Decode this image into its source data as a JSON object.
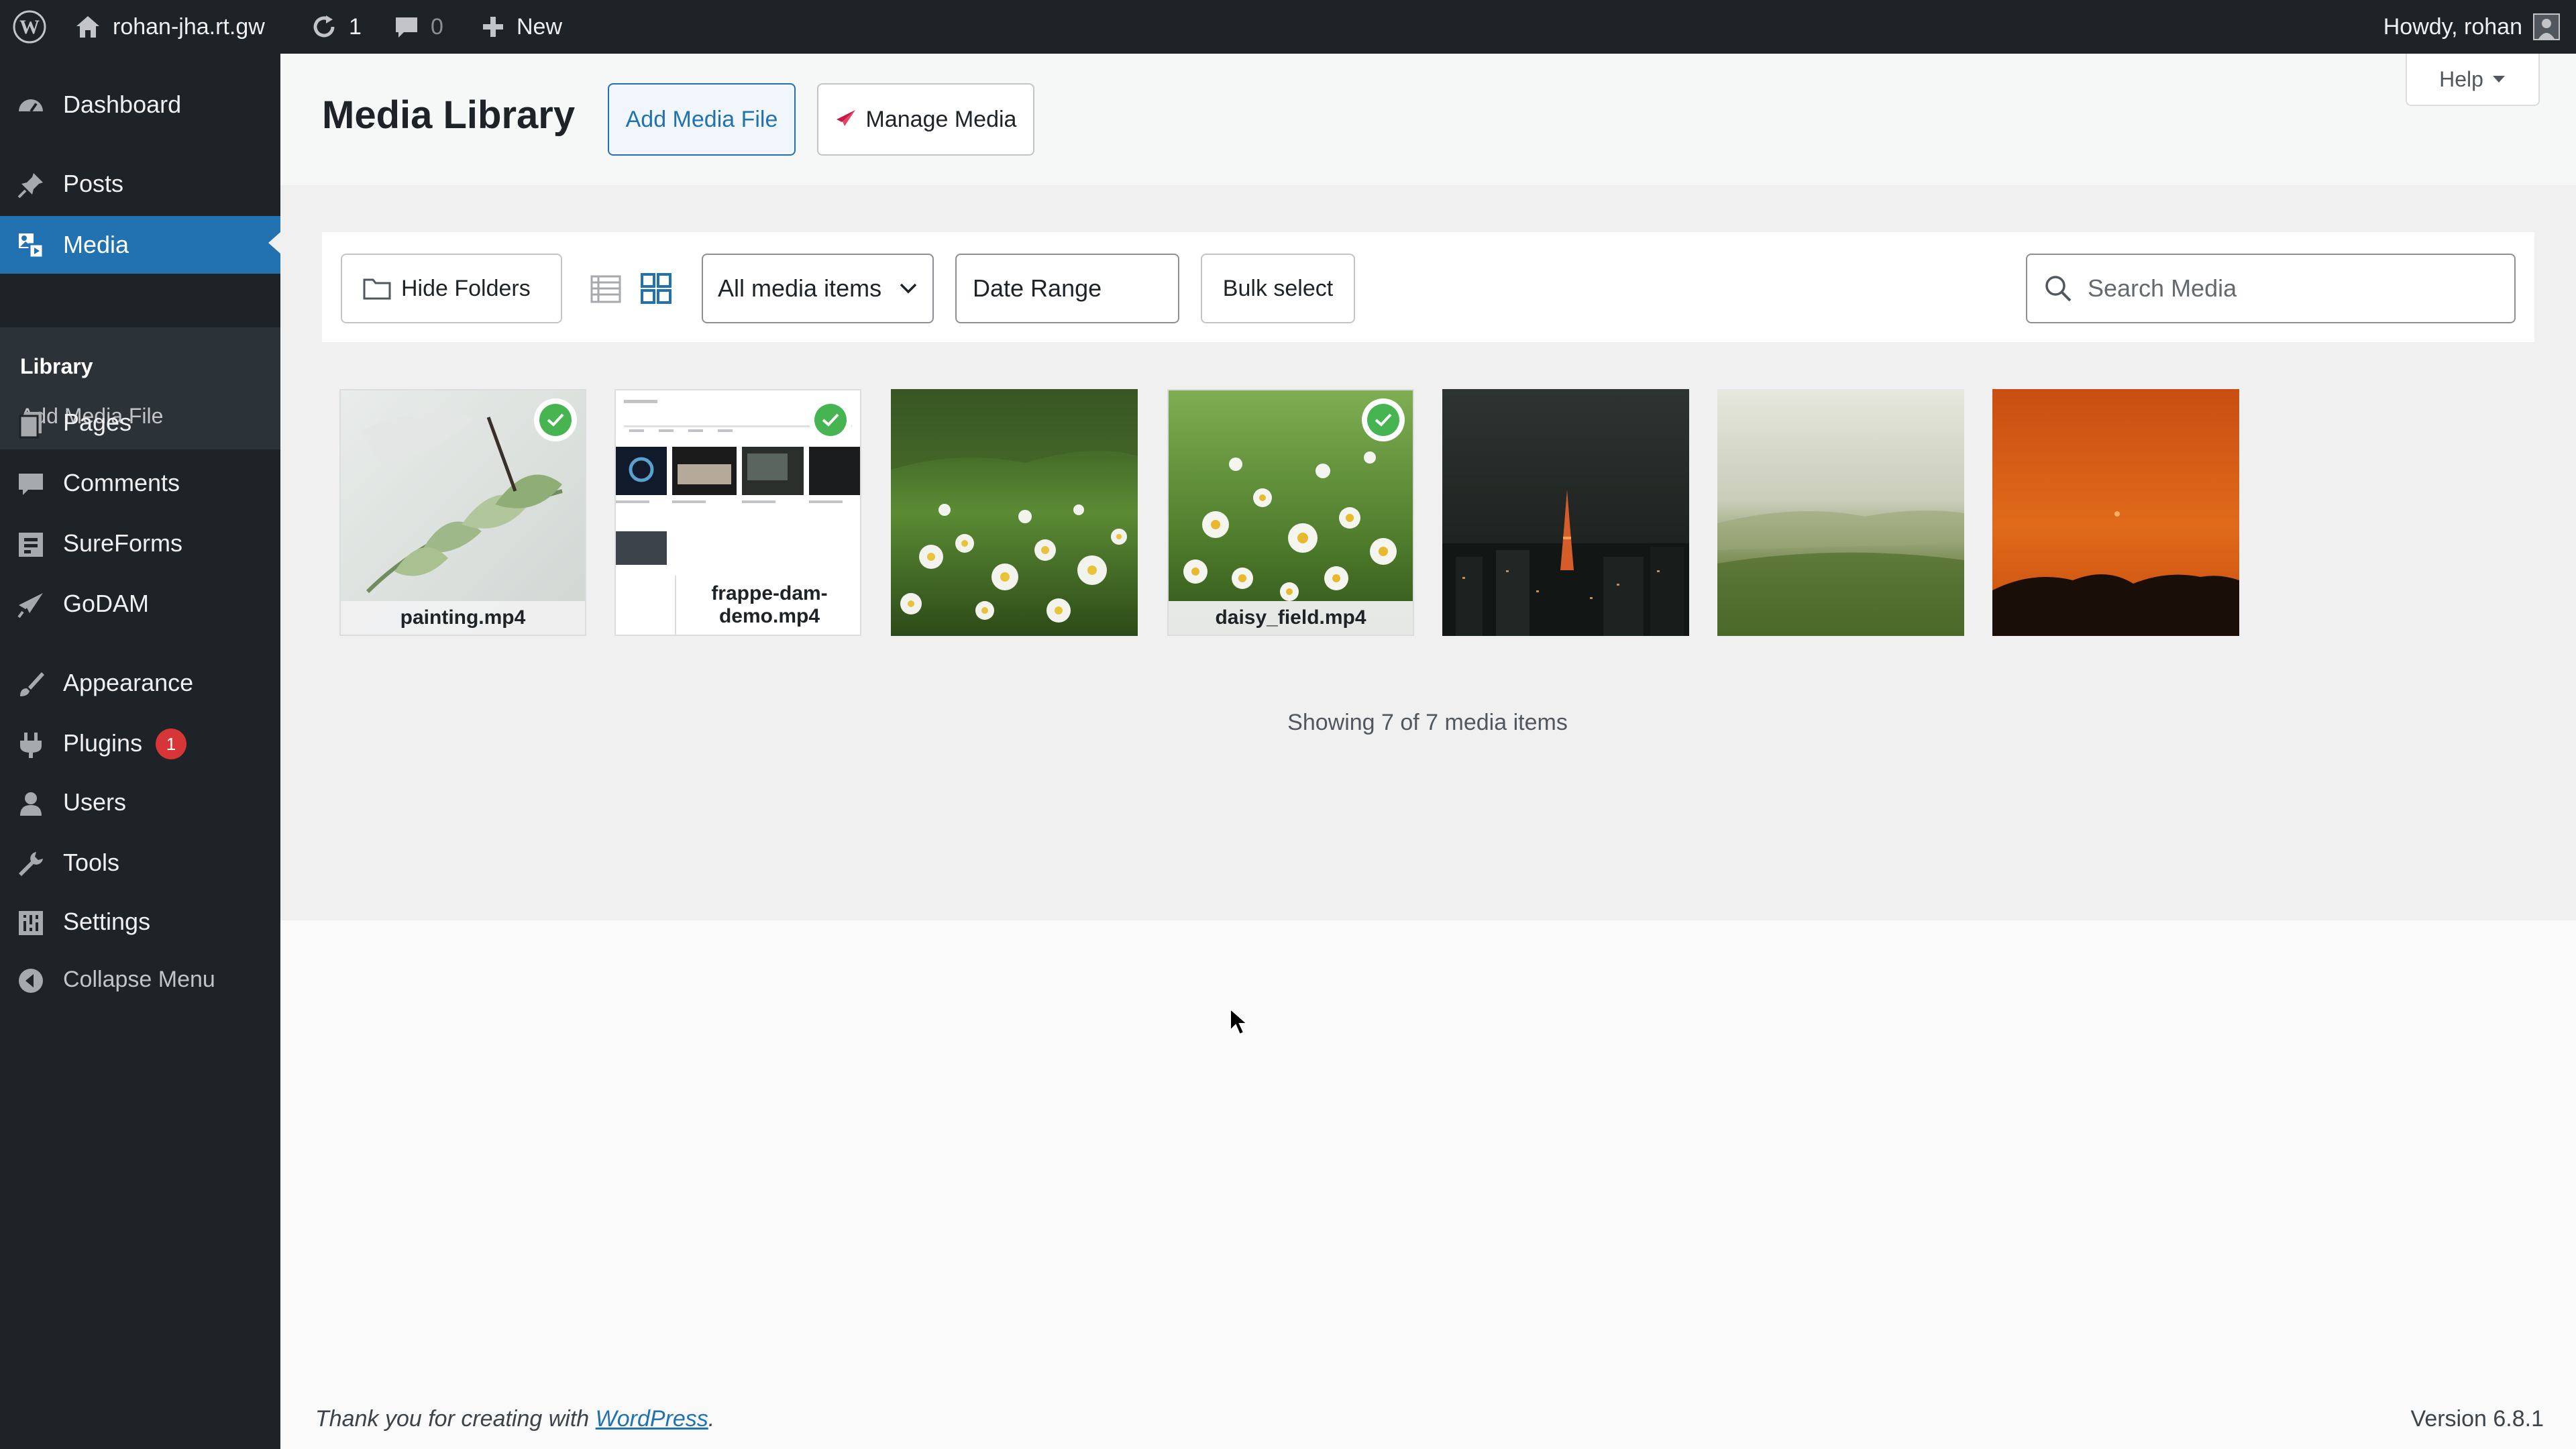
{
  "adminbar": {
    "site_name": "rohan-jha.rt.gw",
    "updates_count": "1",
    "comments_count": "0",
    "new_label": "New",
    "howdy": "Howdy, rohan"
  },
  "sidebar": {
    "items": [
      {
        "label": "Dashboard",
        "icon": "dashboard-icon"
      },
      {
        "label": "Posts",
        "icon": "pin-icon"
      },
      {
        "label": "Media",
        "icon": "media-icon"
      },
      {
        "label": "Pages",
        "icon": "pages-icon"
      },
      {
        "label": "Comments",
        "icon": "comment-icon"
      },
      {
        "label": "SureForms",
        "icon": "form-icon"
      },
      {
        "label": "GoDAM",
        "icon": "godam-icon"
      },
      {
        "label": "Appearance",
        "icon": "brush-icon"
      },
      {
        "label": "Plugins",
        "icon": "plug-icon"
      },
      {
        "label": "Users",
        "icon": "user-icon"
      },
      {
        "label": "Tools",
        "icon": "wrench-icon"
      },
      {
        "label": "Settings",
        "icon": "settings-icon"
      },
      {
        "label": "Collapse Menu",
        "icon": "collapse-icon"
      }
    ],
    "submenu": [
      "Library",
      "Add Media File"
    ],
    "plugins_badge": "1"
  },
  "header": {
    "title": "Media Library",
    "add_media_label": "Add Media File",
    "manage_media_label": "Manage Media",
    "help_label": "Help"
  },
  "toolbar": {
    "hide_folders_label": "Hide Folders",
    "filter_value": "All media items",
    "date_range_label": "Date Range",
    "bulk_select_label": "Bulk select",
    "search_placeholder": "Search Media"
  },
  "media": [
    {
      "caption": "painting.mp4",
      "selected": true
    },
    {
      "caption": "frappe-dam-demo.mp4",
      "selected": true
    },
    {
      "caption": "",
      "selected": false
    },
    {
      "caption": "daisy_field.mp4",
      "selected": true
    },
    {
      "caption": "",
      "selected": false
    },
    {
      "caption": "",
      "selected": false
    },
    {
      "caption": "",
      "selected": false
    }
  ],
  "count_text": "Showing 7 of 7 media items",
  "footer": {
    "thanks_prefix": "Thank you for creating with ",
    "thanks_link": "WordPress",
    "thanks_suffix": ".",
    "version": "Version 6.8.1"
  },
  "colors": {
    "adminbar_bg": "#1d2327",
    "accent": "#2271b1",
    "selected_check": "#46b450",
    "badge": "#d63638"
  }
}
